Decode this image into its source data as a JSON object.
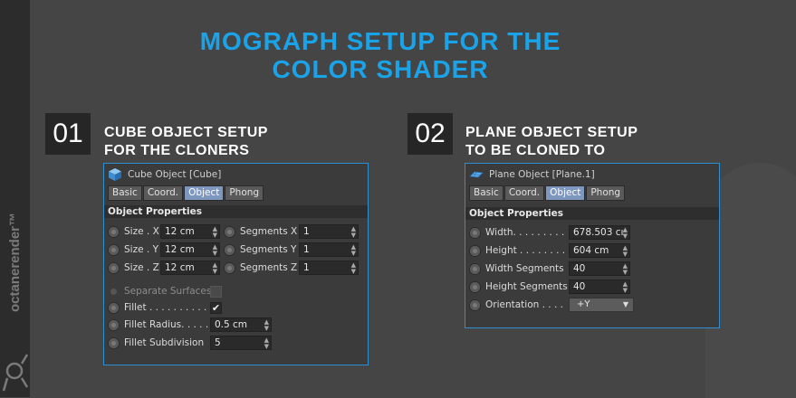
{
  "brand": {
    "name": "octanerender",
    "tm": "™"
  },
  "title": {
    "line1": "MOGRAPH SETUP FOR THE",
    "line2": "COLOR SHADER"
  },
  "steps": [
    {
      "number": "01",
      "title_line1": "CUBE OBJECT SETUP",
      "title_line2": "FOR THE CLONERS",
      "panel": {
        "title": "Cube Object [Cube]",
        "tabs": [
          "Basic",
          "Coord.",
          "Object",
          "Phong"
        ],
        "active_tab": "Object",
        "section": "Object Properties",
        "size_labels": [
          "Size . X",
          "Size . Y",
          "Size . Z"
        ],
        "size_values": [
          "12 cm",
          "12 cm",
          "12 cm"
        ],
        "segment_labels": [
          "Segments X",
          "Segments Y",
          "Segments Z"
        ],
        "segment_values": [
          "1",
          "1",
          "1"
        ],
        "separate_surfaces": "Separate Surfaces",
        "fillet": "Fillet . . . . . . . . . . .",
        "fillet_check": "✔",
        "fillet_radius": "Fillet Radius. . . . .",
        "fillet_radius_value": "0.5 cm",
        "fillet_subdivision": "Fillet Subdivision",
        "fillet_subdivision_value": "5"
      }
    },
    {
      "number": "02",
      "title_line1": "PLANE OBJECT SETUP",
      "title_line2": "TO BE CLONED TO",
      "panel": {
        "title": "Plane Object [Plane.1]",
        "tabs": [
          "Basic",
          "Coord.",
          "Object",
          "Phong"
        ],
        "active_tab": "Object",
        "section": "Object Properties",
        "rows": [
          {
            "label": "Width. . . . . . . . .",
            "value": "678.503 cı"
          },
          {
            "label": "Height . . . . . . . .",
            "value": "604 cm"
          },
          {
            "label": "Width Segments",
            "value": "40"
          },
          {
            "label": "Height Segments",
            "value": "40"
          }
        ],
        "orientation_label": "Orientation . . . .",
        "orientation_value": "+Y"
      }
    }
  ],
  "colors": {
    "accent": "#1aa3e8",
    "panel_border": "#2d8ed0",
    "active_tab": "#7d97bf"
  }
}
